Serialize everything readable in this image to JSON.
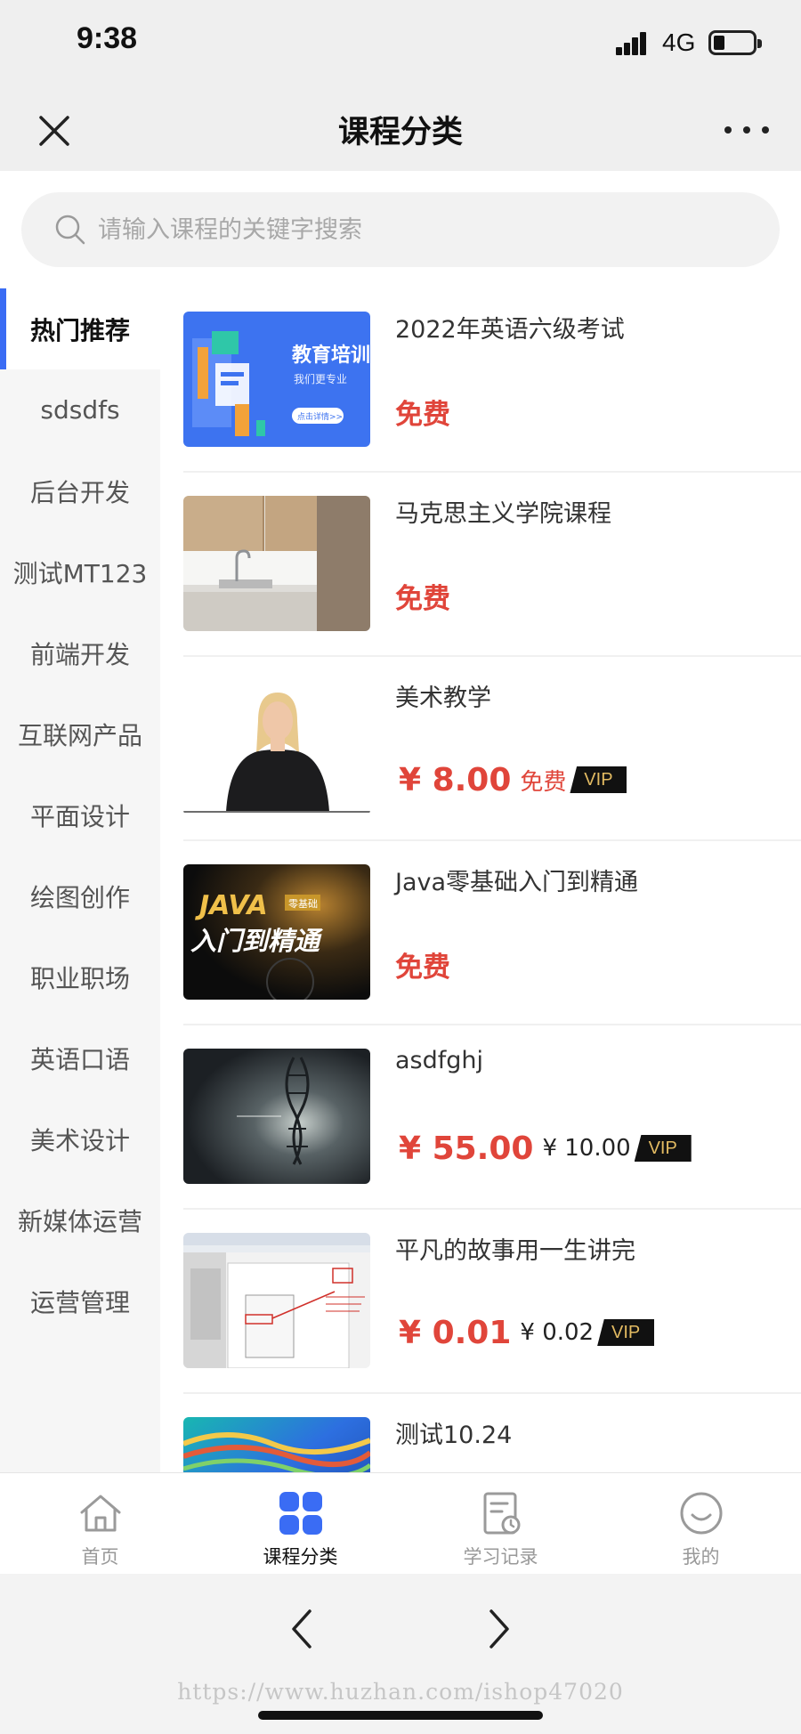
{
  "status_bar": {
    "time": "9:38",
    "network": "4G"
  },
  "header": {
    "title": "课程分类"
  },
  "search": {
    "placeholder": "请输入课程的关键字搜索"
  },
  "sidebar": {
    "items": [
      {
        "label": "热门推荐",
        "active": true
      },
      {
        "label": "sdsdfs"
      },
      {
        "label": "后台开发"
      },
      {
        "label": "测试MT123"
      },
      {
        "label": "前端开发"
      },
      {
        "label": "互联网产品"
      },
      {
        "label": "平面设计"
      },
      {
        "label": "绘图创作"
      },
      {
        "label": "职业职场"
      },
      {
        "label": "英语口语"
      },
      {
        "label": "美术设计"
      },
      {
        "label": "新媒体运营"
      },
      {
        "label": "运营管理"
      }
    ]
  },
  "courses": [
    {
      "title": "2022年英语六级考试",
      "price_tag": "免费",
      "thumbnail_text": "教育培训",
      "thumbnail_subtext": "我们更专业",
      "thumbnail_button": "点击详情>>"
    },
    {
      "title": "马克思主义学院课程",
      "price_tag": "免费"
    },
    {
      "title": "美术教学",
      "price": "¥ 8.00",
      "vip_price": "免费",
      "vip_label": "VIP"
    },
    {
      "title": "Java零基础入门到精通",
      "price_tag": "免费",
      "thumbnail_text": "JAVA",
      "thumbnail_tag": "零基础",
      "thumbnail_subtext": "入门到精通"
    },
    {
      "title": "asdfghj",
      "price": "¥ 55.00",
      "vip_price": "¥ 10.00",
      "vip_label": "VIP"
    },
    {
      "title": "平凡的故事用一生讲完",
      "price": "¥ 0.01",
      "vip_price": "¥ 0.02",
      "vip_label": "VIP"
    },
    {
      "title": "测试10.24"
    }
  ],
  "tab_bar": {
    "items": [
      {
        "label": "首页",
        "icon": "home-icon"
      },
      {
        "label": "课程分类",
        "icon": "grid-icon",
        "active": true
      },
      {
        "label": "学习记录",
        "icon": "record-icon"
      },
      {
        "label": "我的",
        "icon": "smile-icon"
      }
    ]
  },
  "browser": {
    "watermark": "https://www.huzhan.com/ishop47020"
  },
  "colors": {
    "accent": "#3a6cf4",
    "price": "#e0453a",
    "vip_gold": "#e3bb62"
  }
}
